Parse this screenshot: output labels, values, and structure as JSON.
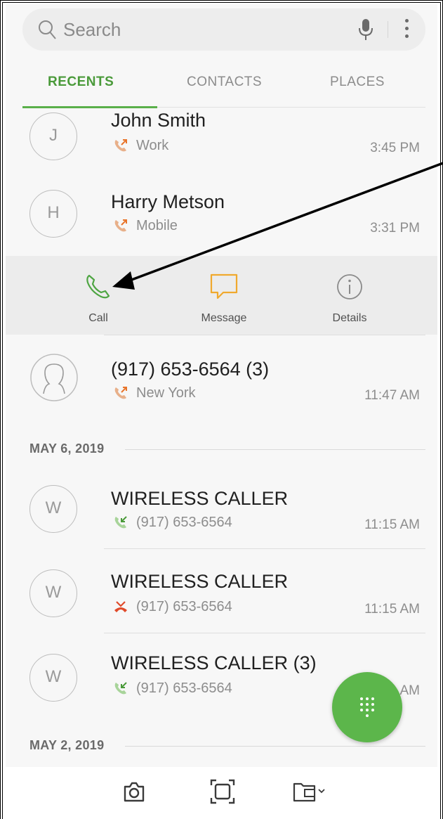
{
  "search": {
    "placeholder": "Search"
  },
  "tabs": [
    {
      "label": "RECENTS",
      "active": true
    },
    {
      "label": "CONTACTS",
      "active": false
    },
    {
      "label": "PLACES",
      "active": false
    }
  ],
  "recents": [
    {
      "initial": "J",
      "name": "John Smith",
      "detail": "Work",
      "time": "3:45 PM",
      "call_type": "outgoing-call-icon"
    },
    {
      "initial": "H",
      "name": "Harry Metson",
      "detail": "Mobile",
      "time": "3:31 PM",
      "call_type": "outgoing-call-icon"
    },
    {
      "initial": "",
      "name": "(917) 653-6564 (3)",
      "detail": "New York",
      "time": "11:47 AM",
      "call_type": "outgoing-call-icon"
    }
  ],
  "actions": {
    "call": "Call",
    "message": "Message",
    "details": "Details"
  },
  "sections": [
    {
      "date": "MAY 6, 2019",
      "items": [
        {
          "initial": "W",
          "name": "WIRELESS CALLER",
          "detail": "(917) 653-6564",
          "time": "11:15 AM",
          "call_type": "incoming-call-icon"
        },
        {
          "initial": "W",
          "name": "WIRELESS CALLER",
          "detail": "(917) 653-6564",
          "time": "11:15 AM",
          "call_type": "missed-call-icon"
        },
        {
          "initial": "W",
          "name": "WIRELESS CALLER (3)",
          "detail": "(917) 653-6564",
          "time": "AM",
          "call_type": "incoming-call-icon"
        }
      ]
    },
    {
      "date": "MAY 2, 2019",
      "items": []
    }
  ],
  "colors": {
    "accent": "#5cb64b",
    "message": "#f0a92e",
    "outgoing": "#e8742a",
    "incoming": "#4a9a3a",
    "missed": "#e04a2a"
  }
}
